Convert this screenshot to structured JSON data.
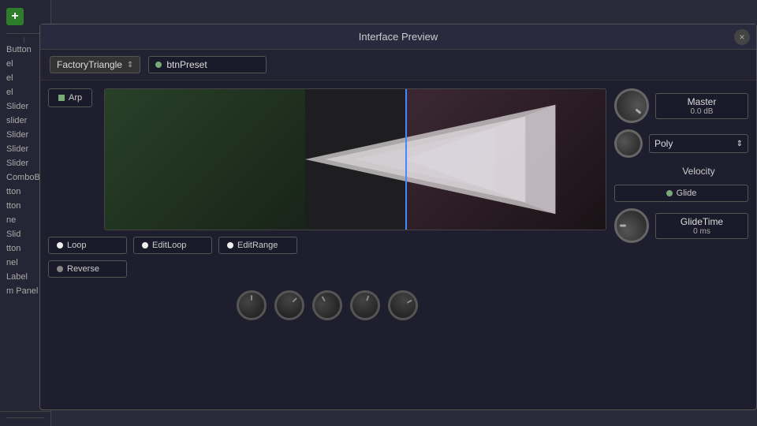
{
  "app": {
    "title": "Interface Preview"
  },
  "leftPanel": {
    "addButtonLabel": "+",
    "items": [
      {
        "label": "Button"
      },
      {
        "label": "el"
      },
      {
        "label": "el"
      },
      {
        "label": "el"
      },
      {
        "label": "Slider"
      },
      {
        "label": "slider"
      },
      {
        "label": "Slider"
      },
      {
        "label": "Slider"
      },
      {
        "label": "Slider"
      },
      {
        "label": "ComboB"
      },
      {
        "label": "tton"
      },
      {
        "label": "tton"
      },
      {
        "label": "ne"
      },
      {
        "label": "Slid"
      },
      {
        "label": "tton"
      },
      {
        "label": "nel"
      },
      {
        "label": "Label"
      },
      {
        "label": "m"
      },
      {
        "label": "Panel"
      }
    ]
  },
  "toolbar": {
    "presetDropdownLabel": "FactoryTriangle",
    "presetInputLabel": "btnPreset"
  },
  "waveformControls": {
    "loopLabel": "Loop",
    "editLoopLabel": "EditLoop",
    "editRangeLabel": "EditRange",
    "reverseLabel": "Reverse"
  },
  "rightPanel": {
    "masterLabel": "Master",
    "masterValue": "0.0 dB",
    "velocityLabel": "Velocity",
    "polyLabel": "Poly",
    "glideLabel": "Glide",
    "glideTimeLabel": "GlideTime",
    "glideTimeValue": "0 ms"
  },
  "arpButton": {
    "label": "Arp"
  },
  "closeButton": {
    "symbol": "×"
  }
}
